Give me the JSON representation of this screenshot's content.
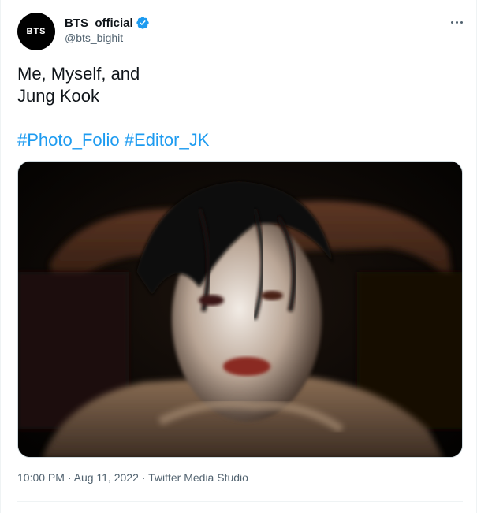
{
  "author": {
    "avatar_text": "BTS",
    "display_name": "BTS_official",
    "handle": "@bts_bighit",
    "verified_color": "#1d9bf0"
  },
  "tweet": {
    "text_lines": [
      "Me, Myself, and",
      "Jung Kook"
    ],
    "hashtags": [
      "#Photo_Folio",
      "#Editor_JK"
    ],
    "link_color": "#1d9bf0"
  },
  "meta": {
    "time": "10:00 PM",
    "separator": "·",
    "date": "Aug 11, 2022",
    "source": "Twitter Media Studio"
  },
  "icons": {
    "more": "more-horizontal-icon",
    "verified": "verified-badge-icon"
  }
}
